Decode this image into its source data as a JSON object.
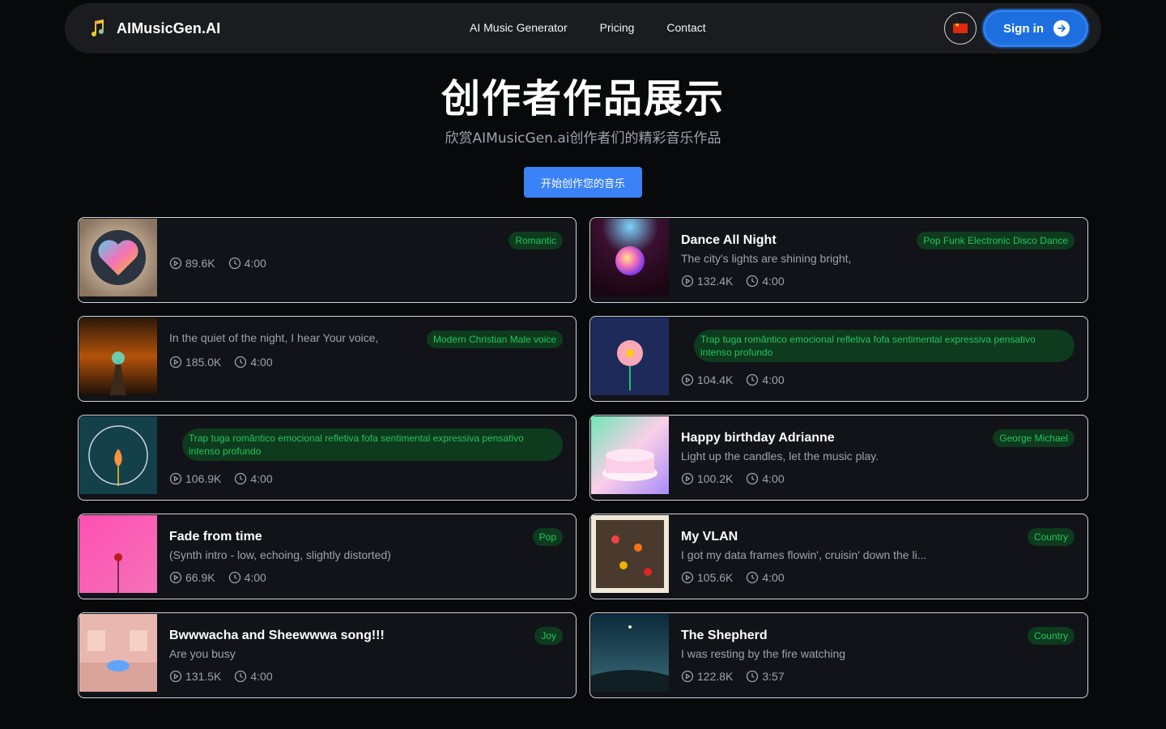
{
  "header": {
    "brand": "AIMusicGen.AI",
    "nav": [
      "AI Music Generator",
      "Pricing",
      "Contact"
    ],
    "signin": "Sign in"
  },
  "hero": {
    "title": "创作者作品展示",
    "subtitle": "欣赏AIMusicGen.ai创作者们的精彩音乐作品",
    "cta": "开始创作您的音乐"
  },
  "cards": [
    {
      "title": "",
      "desc": "",
      "tag": "Romantic",
      "plays": "89.6K",
      "duration": "4:00"
    },
    {
      "title": "Dance All Night",
      "desc": "The city's lights are shining bright,",
      "tag": "Pop Funk Electronic Disco Dance",
      "plays": "132.4K",
      "duration": "4:00"
    },
    {
      "title": "",
      "desc": "In the quiet of the night, I hear Your voice,",
      "tag": "Modern Christian Male voice",
      "plays": "185.0K",
      "duration": "4:00"
    },
    {
      "title": "",
      "desc": "",
      "tag": "Trap tuga romântico emocional refletiva fofa sentimental expressiva pensativo intenso profundo",
      "plays": "104.4K",
      "duration": "4:00"
    },
    {
      "title": "",
      "desc": "",
      "tag": "Trap tuga romântico emocional refletiva fofa sentimental expressiva pensativo intenso profundo",
      "plays": "106.9K",
      "duration": "4:00"
    },
    {
      "title": "Happy birthday Adrianne",
      "desc": "Light up the candles, let the music play.",
      "tag": "George Michael",
      "plays": "100.2K",
      "duration": "4:00"
    },
    {
      "title": "Fade from time",
      "desc": "(Synth intro - low, echoing, slightly distorted)",
      "tag": "Pop",
      "plays": "66.9K",
      "duration": "4:00"
    },
    {
      "title": "My VLAN",
      "desc": "I got my data frames flowin', cruisin' down the li...",
      "tag": "Country",
      "plays": "105.6K",
      "duration": "4:00"
    },
    {
      "title": "Bwwwacha and Sheewwwa song!!!",
      "desc": "Are you busy",
      "tag": "Joy",
      "plays": "131.5K",
      "duration": "4:00"
    },
    {
      "title": "The Shepherd",
      "desc": "I was resting by the fire watching",
      "tag": "Country",
      "plays": "122.8K",
      "duration": "3:57"
    }
  ]
}
